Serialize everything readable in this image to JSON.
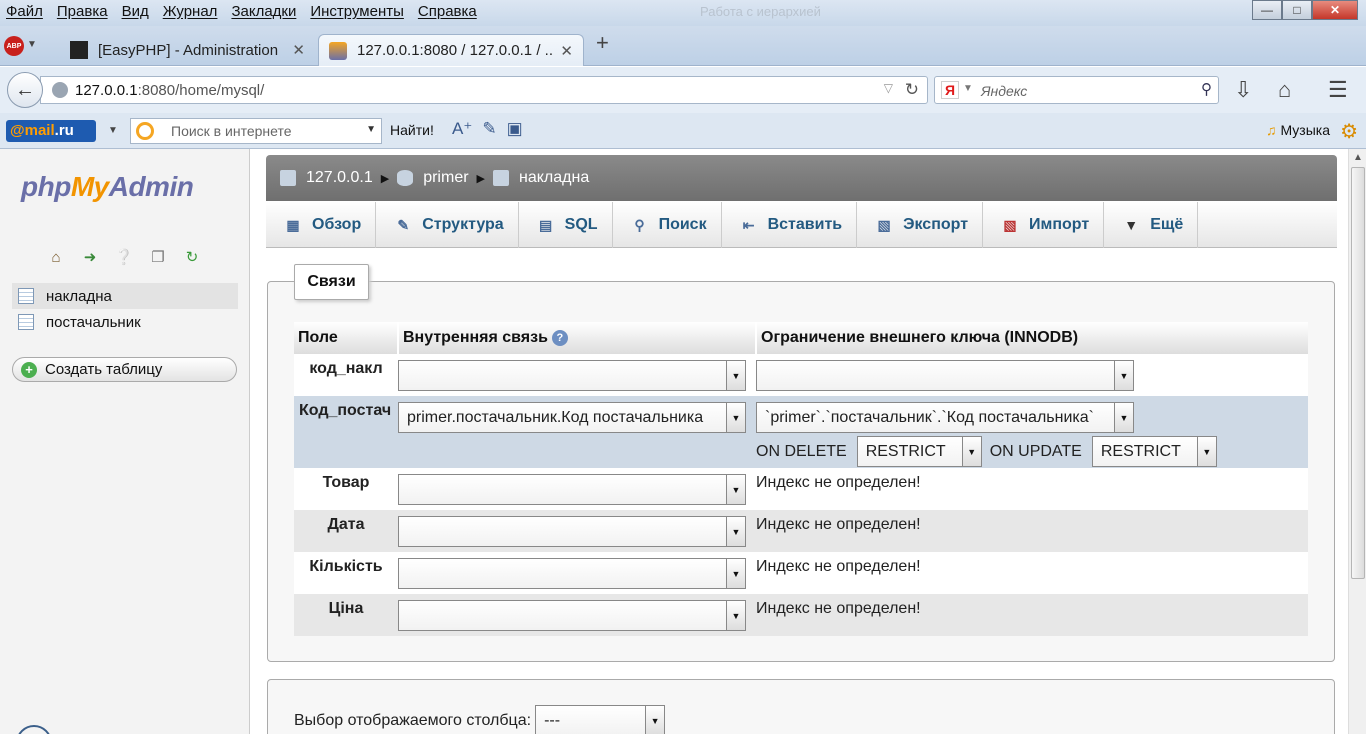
{
  "browser": {
    "menu": [
      "Файл",
      "Правка",
      "Вид",
      "Журнал",
      "Закладки",
      "Инструменты",
      "Справка"
    ],
    "window_bg_title": "Работа с иерархией",
    "tabs": [
      {
        "title": "[EasyPHP] - Administration",
        "active": false
      },
      {
        "title": "127.0.0.1:8080 / 127.0.0.1 / ...",
        "active": true
      }
    ],
    "url_host": "127.0.0.1",
    "url_rest": ":8080/home/mysql/",
    "search_placeholder": "Яндекс",
    "search_engine_letter": "Я",
    "abp_label": "ABP"
  },
  "mailbar": {
    "logo_at": "@mail",
    "logo_ru": ".ru",
    "search_placeholder": "Поиск в интернете",
    "find_label": "Найти!",
    "music_label": "Музыка"
  },
  "left": {
    "logo_php": "php",
    "logo_my": "My",
    "logo_admin": "Admin",
    "tables": [
      "накладна",
      "постачальник"
    ],
    "create_table": "Создать таблицу"
  },
  "breadcrumb": {
    "server": "127.0.0.1",
    "db": "primer",
    "table": "накладна"
  },
  "topmenu": [
    {
      "label": "Обзор",
      "icon": "browse-icon"
    },
    {
      "label": "Структура",
      "icon": "structure-icon"
    },
    {
      "label": "SQL",
      "icon": "sql-icon"
    },
    {
      "label": "Поиск",
      "icon": "search-icon"
    },
    {
      "label": "Вставить",
      "icon": "insert-icon"
    },
    {
      "label": "Экспорт",
      "icon": "export-icon"
    },
    {
      "label": "Импорт",
      "icon": "import-icon"
    },
    {
      "label": "Ещё",
      "icon": "more-icon"
    }
  ],
  "relations": {
    "legend": "Связи",
    "headers": {
      "field": "Поле",
      "internal": "Внутренняя связь",
      "foreign": "Ограничение внешнего ключа (INNODB)"
    },
    "rows": [
      {
        "field": "код_накл",
        "internal": "",
        "foreign": ""
      },
      {
        "field": "Код_постач",
        "internal": "primer.постачальник.Код постачальника",
        "foreign": "`primer`.`постачальник`.`Код постачальника`"
      },
      {
        "field": "Товар",
        "internal": "",
        "note": "Индекс не определен!"
      },
      {
        "field": "Дата",
        "internal": "",
        "note": "Индекс не определен!"
      },
      {
        "field": "Кількість",
        "internal": "",
        "note": "Индекс не определен!"
      },
      {
        "field": "Ціна",
        "internal": "",
        "note": "Индекс не определен!"
      }
    ],
    "on_delete_label": "ON DELETE",
    "on_delete_value": "RESTRICT",
    "on_update_label": "ON UPDATE",
    "on_update_value": "RESTRICT"
  },
  "display_column": {
    "label": "Выбор отображаемого столбца:",
    "value": "---"
  }
}
